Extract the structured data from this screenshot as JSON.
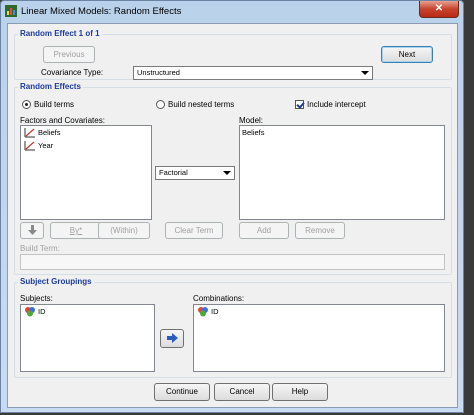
{
  "window": {
    "title": "Linear Mixed Models: Random Effects",
    "close_glyph": "✕"
  },
  "random_effect_group": {
    "title": "Random Effect 1 of 1",
    "previous_label": "Previous",
    "next_label": "Next",
    "covariance_label": "Covariance Type:",
    "covariance_value": "Unstructured"
  },
  "random_effects": {
    "title": "Random Effects",
    "build_terms_label": "Build terms",
    "build_nested_label": "Build nested terms",
    "include_intercept_label": "Include intercept",
    "build_terms_selected": true,
    "build_nested_selected": false,
    "include_intercept_checked": true,
    "factors_label": "Factors and Covariates:",
    "factors": [
      {
        "label": "Beliefs",
        "icon": "scale-icon"
      },
      {
        "label": "Year",
        "icon": "scale-icon"
      }
    ],
    "model_label": "Model:",
    "model_items": [
      "Beliefs"
    ],
    "term_type": "Factorial",
    "by_label": "By*",
    "within_label": "(Within)",
    "clear_term_label": "Clear Term",
    "add_label": "Add",
    "remove_label": "Remove",
    "build_term_label": "Build Term:"
  },
  "subject_groupings": {
    "title": "Subject Groupings",
    "subjects_label": "Subjects:",
    "subjects": [
      {
        "label": "ID",
        "icon": "nominal-icon"
      }
    ],
    "combinations_label": "Combinations:",
    "combinations": [
      {
        "label": "ID",
        "icon": "nominal-icon"
      }
    ]
  },
  "footer": {
    "continue_label": "Continue",
    "cancel_label": "Cancel",
    "help_label": "Help"
  }
}
